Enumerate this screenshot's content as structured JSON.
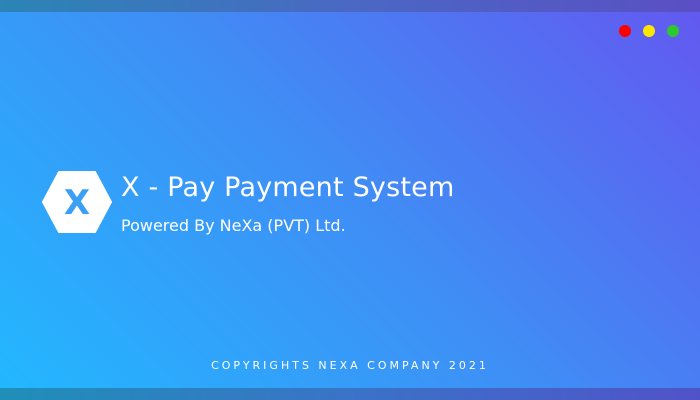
{
  "app": {
    "title": "X - Pay Payment System",
    "subtitle": "Powered By NeXa (PVT) Ltd.",
    "copyright": "COPYRIGHTS NEXA COMPANY 2021"
  },
  "logo": {
    "icon": "hexagon-x-logo-icon",
    "glyph": "X"
  },
  "window_controls": [
    {
      "name": "close",
      "color": "#ff0000"
    },
    {
      "name": "minimize",
      "color": "#ffe600"
    },
    {
      "name": "maximize",
      "color": "#2ec82e"
    }
  ],
  "colors": {
    "gradient_start": "#22b8ff",
    "gradient_end": "#6358f0",
    "logo_fill": "#ffffff",
    "logo_glyph": "#3aa0f6",
    "text": "#ffffff"
  }
}
